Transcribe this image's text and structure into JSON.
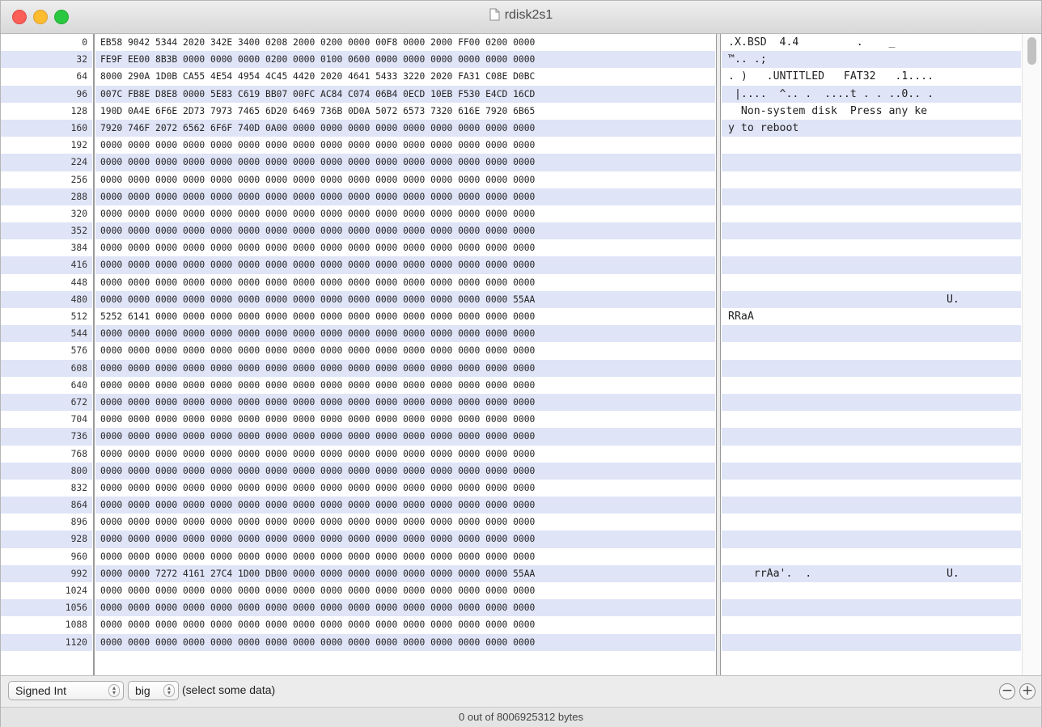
{
  "window": {
    "title": "rdisk2s1",
    "icon": "document-icon"
  },
  "hex_view": {
    "rows": [
      {
        "offset": "0",
        "hex": "EB58 9042 5344 2020 342E 3400 0208 2000 0200 0000 00F8 0000 2000 FF00 0200 0000",
        "ascii": ".X.BSD  4.4         .    _"
      },
      {
        "offset": "32",
        "hex": "FE9F EE00 8B3B 0000 0000 0000 0200 0000 0100 0600 0000 0000 0000 0000 0000 0000",
        "ascii": "™.. .;"
      },
      {
        "offset": "64",
        "hex": "8000 290A 1D0B CA55 4E54 4954 4C45 4420 2020 4641 5433 3220 2020 FA31 C08E D0BC",
        "ascii": ". )   .UNTITLED   FAT32   .1...."
      },
      {
        "offset": "96",
        "hex": "007C FB8E D8E8 0000 5E83 C619 BB07 00FC AC84 C074 06B4 0ECD 10EB F530 E4CD 16CD",
        "ascii": " |....  ^.. .  ....t . . ..0.. ."
      },
      {
        "offset": "128",
        "hex": "190D 0A4E 6F6E 2D73 7973 7465 6D20 6469 736B 0D0A 5072 6573 7320 616E 7920 6B65",
        "ascii": "  Non-system disk  Press any ke"
      },
      {
        "offset": "160",
        "hex": "7920 746F 2072 6562 6F6F 740D 0A00 0000 0000 0000 0000 0000 0000 0000 0000 0000",
        "ascii": "y to reboot"
      },
      {
        "offset": "192",
        "hex": "0000 0000 0000 0000 0000 0000 0000 0000 0000 0000 0000 0000 0000 0000 0000 0000",
        "ascii": ""
      },
      {
        "offset": "224",
        "hex": "0000 0000 0000 0000 0000 0000 0000 0000 0000 0000 0000 0000 0000 0000 0000 0000",
        "ascii": ""
      },
      {
        "offset": "256",
        "hex": "0000 0000 0000 0000 0000 0000 0000 0000 0000 0000 0000 0000 0000 0000 0000 0000",
        "ascii": ""
      },
      {
        "offset": "288",
        "hex": "0000 0000 0000 0000 0000 0000 0000 0000 0000 0000 0000 0000 0000 0000 0000 0000",
        "ascii": ""
      },
      {
        "offset": "320",
        "hex": "0000 0000 0000 0000 0000 0000 0000 0000 0000 0000 0000 0000 0000 0000 0000 0000",
        "ascii": ""
      },
      {
        "offset": "352",
        "hex": "0000 0000 0000 0000 0000 0000 0000 0000 0000 0000 0000 0000 0000 0000 0000 0000",
        "ascii": ""
      },
      {
        "offset": "384",
        "hex": "0000 0000 0000 0000 0000 0000 0000 0000 0000 0000 0000 0000 0000 0000 0000 0000",
        "ascii": ""
      },
      {
        "offset": "416",
        "hex": "0000 0000 0000 0000 0000 0000 0000 0000 0000 0000 0000 0000 0000 0000 0000 0000",
        "ascii": ""
      },
      {
        "offset": "448",
        "hex": "0000 0000 0000 0000 0000 0000 0000 0000 0000 0000 0000 0000 0000 0000 0000 0000",
        "ascii": ""
      },
      {
        "offset": "480",
        "hex": "0000 0000 0000 0000 0000 0000 0000 0000 0000 0000 0000 0000 0000 0000 0000 55AA",
        "ascii": "                                  U."
      },
      {
        "offset": "512",
        "hex": "5252 6141 0000 0000 0000 0000 0000 0000 0000 0000 0000 0000 0000 0000 0000 0000",
        "ascii": "RRaA"
      },
      {
        "offset": "544",
        "hex": "0000 0000 0000 0000 0000 0000 0000 0000 0000 0000 0000 0000 0000 0000 0000 0000",
        "ascii": ""
      },
      {
        "offset": "576",
        "hex": "0000 0000 0000 0000 0000 0000 0000 0000 0000 0000 0000 0000 0000 0000 0000 0000",
        "ascii": ""
      },
      {
        "offset": "608",
        "hex": "0000 0000 0000 0000 0000 0000 0000 0000 0000 0000 0000 0000 0000 0000 0000 0000",
        "ascii": ""
      },
      {
        "offset": "640",
        "hex": "0000 0000 0000 0000 0000 0000 0000 0000 0000 0000 0000 0000 0000 0000 0000 0000",
        "ascii": ""
      },
      {
        "offset": "672",
        "hex": "0000 0000 0000 0000 0000 0000 0000 0000 0000 0000 0000 0000 0000 0000 0000 0000",
        "ascii": ""
      },
      {
        "offset": "704",
        "hex": "0000 0000 0000 0000 0000 0000 0000 0000 0000 0000 0000 0000 0000 0000 0000 0000",
        "ascii": ""
      },
      {
        "offset": "736",
        "hex": "0000 0000 0000 0000 0000 0000 0000 0000 0000 0000 0000 0000 0000 0000 0000 0000",
        "ascii": ""
      },
      {
        "offset": "768",
        "hex": "0000 0000 0000 0000 0000 0000 0000 0000 0000 0000 0000 0000 0000 0000 0000 0000",
        "ascii": ""
      },
      {
        "offset": "800",
        "hex": "0000 0000 0000 0000 0000 0000 0000 0000 0000 0000 0000 0000 0000 0000 0000 0000",
        "ascii": ""
      },
      {
        "offset": "832",
        "hex": "0000 0000 0000 0000 0000 0000 0000 0000 0000 0000 0000 0000 0000 0000 0000 0000",
        "ascii": ""
      },
      {
        "offset": "864",
        "hex": "0000 0000 0000 0000 0000 0000 0000 0000 0000 0000 0000 0000 0000 0000 0000 0000",
        "ascii": ""
      },
      {
        "offset": "896",
        "hex": "0000 0000 0000 0000 0000 0000 0000 0000 0000 0000 0000 0000 0000 0000 0000 0000",
        "ascii": ""
      },
      {
        "offset": "928",
        "hex": "0000 0000 0000 0000 0000 0000 0000 0000 0000 0000 0000 0000 0000 0000 0000 0000",
        "ascii": ""
      },
      {
        "offset": "960",
        "hex": "0000 0000 0000 0000 0000 0000 0000 0000 0000 0000 0000 0000 0000 0000 0000 0000",
        "ascii": ""
      },
      {
        "offset": "992",
        "hex": "0000 0000 7272 4161 27C4 1D00 DB00 0000 0000 0000 0000 0000 0000 0000 0000 55AA",
        "ascii": "    rrAa'.  .                     U."
      },
      {
        "offset": "1024",
        "hex": "0000 0000 0000 0000 0000 0000 0000 0000 0000 0000 0000 0000 0000 0000 0000 0000",
        "ascii": ""
      },
      {
        "offset": "1056",
        "hex": "0000 0000 0000 0000 0000 0000 0000 0000 0000 0000 0000 0000 0000 0000 0000 0000",
        "ascii": ""
      },
      {
        "offset": "1088",
        "hex": "0000 0000 0000 0000 0000 0000 0000 0000 0000 0000 0000 0000 0000 0000 0000 0000",
        "ascii": ""
      },
      {
        "offset": "1120",
        "hex": "0000 0000 0000 0000 0000 0000 0000 0000 0000 0000 0000 0000 0000 0000 0000 0000",
        "ascii": ""
      }
    ]
  },
  "controls": {
    "type_selector": "Signed Int",
    "endian_selector": "big",
    "selection_message": "(select some data)",
    "remove_label": "−",
    "add_label": "+"
  },
  "status": {
    "text": "0 out of 8006925312 bytes"
  },
  "colors": {
    "stripe": "#dfe4f7",
    "close": "#fc5f57",
    "minimize": "#fdbc2e",
    "maximize": "#29c840"
  }
}
